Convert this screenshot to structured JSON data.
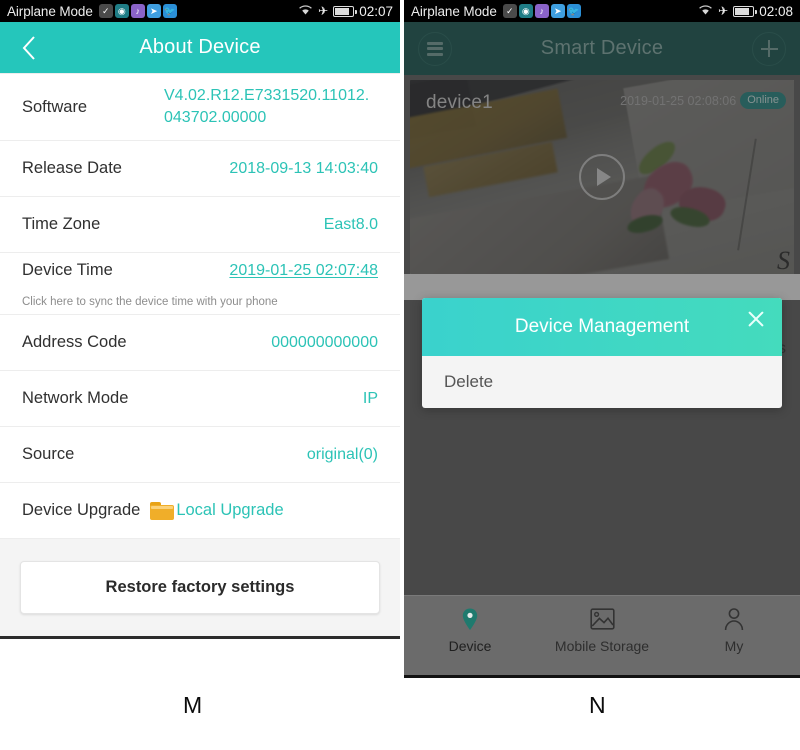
{
  "status_bar": {
    "label": "Airplane Mode",
    "app_icon_glyphs": [
      "check-badge-icon",
      "camera-app-icon",
      "music-app-icon",
      "telegram-app-icon",
      "twitter-app-icon"
    ],
    "wifi_icon": "wifi-icon",
    "airplane_icon": "airplane-icon",
    "battery_icon": "battery-icon",
    "time_left": "02:07",
    "time_right": "02:08"
  },
  "left_screen": {
    "title": "About Device",
    "back_icon": "back-chevron-icon",
    "rows": [
      {
        "label": "Software",
        "value": "V4.02.R12.E7331520.11012.043702.00000"
      },
      {
        "label": "Release Date",
        "value": "2018-09-13 14:03:40"
      },
      {
        "label": "Time Zone",
        "value": "East8.0"
      },
      {
        "label": "Device Time",
        "value": "2019-01-25 02:07:48",
        "hint": "Click here to sync the device time with your phone"
      },
      {
        "label": "Address Code",
        "value": "000000000000"
      },
      {
        "label": "Network Mode",
        "value": "IP"
      },
      {
        "label": "Source",
        "value": "original(0)"
      },
      {
        "label": "Device Upgrade",
        "value": "Local Upgrade",
        "icon": "folder-icon"
      }
    ],
    "restore_button": "Restore factory settings"
  },
  "right_screen": {
    "title": "Smart Device",
    "menu_icon": "hamburger-menu-icon",
    "add_icon": "plus-icon",
    "video_card": {
      "device_name": "device1",
      "timestamp": "2019-01-25 02:08:06",
      "status_badge": "Online",
      "play_icon": "play-icon",
      "watermark": "S"
    },
    "behind_dialog_text": "gs",
    "dialog": {
      "title": "Device Management",
      "close_icon": "close-icon",
      "items": [
        "Delete"
      ]
    },
    "bottom_nav": [
      {
        "label": "Device",
        "icon": "location-pin-icon",
        "active": true
      },
      {
        "label": "Mobile Storage",
        "icon": "image-icon",
        "active": false
      },
      {
        "label": "My",
        "icon": "person-icon",
        "active": false
      }
    ]
  },
  "captions": {
    "left": "M",
    "right": "N"
  },
  "colors": {
    "teal_accent": "#2cc3b6",
    "appbar_teal": "#25c6bb",
    "dialog_gradient_start": "#3ad2cd",
    "dialog_gradient_end": "#44dbbd",
    "dimmed_appbar": "#1b5d56",
    "scrim": "#666666",
    "nav_active": "#1f7a6e"
  }
}
